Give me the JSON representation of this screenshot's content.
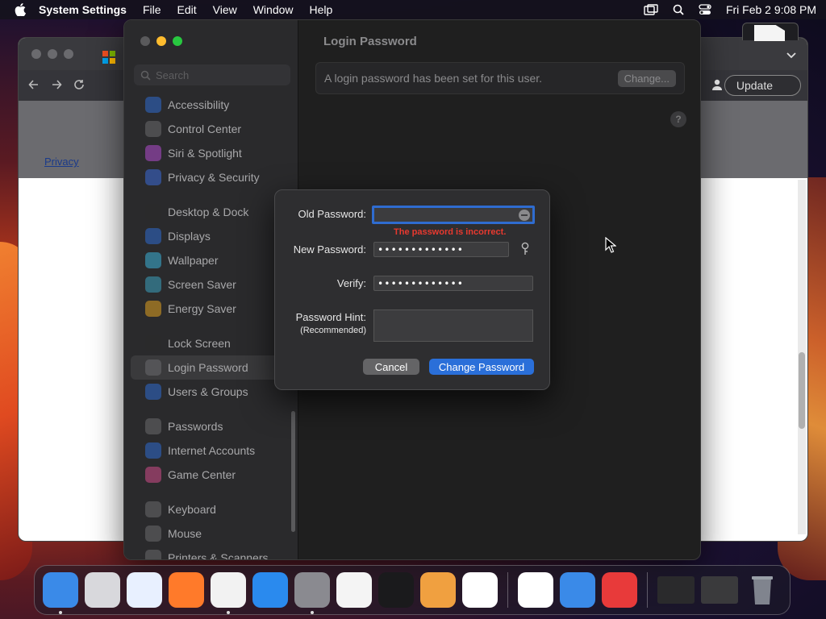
{
  "menubar": {
    "app_name": "System Settings",
    "items": [
      "File",
      "Edit",
      "View",
      "Window",
      "Help"
    ],
    "clock": "Fri Feb 2  9:08 PM"
  },
  "browser": {
    "privacy_link": "Privacy",
    "update_label": "Update"
  },
  "settings": {
    "search_placeholder": "Search",
    "sidebar": [
      {
        "label": "Accessibility",
        "icon": "accessibility-icon",
        "color": "#2e6ad0"
      },
      {
        "label": "Control Center",
        "icon": "control-center-icon",
        "color": "#6a6a6e"
      },
      {
        "label": "Siri & Spotlight",
        "icon": "siri-icon",
        "color": "#b04ad0"
      },
      {
        "label": "Privacy & Security",
        "icon": "hand-icon",
        "color": "#3a6ad8"
      },
      {
        "label": "Desktop & Dock",
        "icon": "desktop-icon",
        "color": "#2a2a2c"
      },
      {
        "label": "Displays",
        "icon": "displays-icon",
        "color": "#2e6ad0"
      },
      {
        "label": "Wallpaper",
        "icon": "wallpaper-icon",
        "color": "#3ab0d8"
      },
      {
        "label": "Screen Saver",
        "icon": "screen-saver-icon",
        "color": "#3aa0c0"
      },
      {
        "label": "Energy Saver",
        "icon": "energy-icon",
        "color": "#e0a020"
      },
      {
        "label": "Lock Screen",
        "icon": "lock-icon",
        "color": "#2a2a2c"
      },
      {
        "label": "Login Password",
        "icon": "login-password-icon",
        "color": "#6a6a6e"
      },
      {
        "label": "Users & Groups",
        "icon": "users-icon",
        "color": "#2e6ad0"
      },
      {
        "label": "Passwords",
        "icon": "key-icon",
        "color": "#6a6a6e"
      },
      {
        "label": "Internet Accounts",
        "icon": "at-icon",
        "color": "#2e6ad0"
      },
      {
        "label": "Game Center",
        "icon": "game-center-icon",
        "color": "#d04a8a"
      },
      {
        "label": "Keyboard",
        "icon": "keyboard-icon",
        "color": "#6a6a6e"
      },
      {
        "label": "Mouse",
        "icon": "mouse-icon",
        "color": "#6a6a6e"
      },
      {
        "label": "Printers & Scanners",
        "icon": "printer-icon",
        "color": "#6a6a6e"
      }
    ],
    "active_item": "Login Password",
    "pane_title": "Login Password",
    "info_text": "A login password has been set for this user.",
    "change_label": "Change...",
    "help_label": "?"
  },
  "dialog": {
    "old_password_label": "Old Password:",
    "old_password_value": "",
    "error_text": "The password is incorrect.",
    "new_password_label": "New Password:",
    "new_password_value": "•••••••••••••",
    "verify_label": "Verify:",
    "verify_value": "•••••••••••••",
    "hint_label": "Password Hint:",
    "hint_sub": "(Recommended)",
    "hint_value": "",
    "cancel_label": "Cancel",
    "submit_label": "Change Password"
  },
  "dock": [
    {
      "name": "finder",
      "color": "#3a8ae8",
      "running": true
    },
    {
      "name": "launchpad",
      "color": "#d8d8dc",
      "running": false
    },
    {
      "name": "safari",
      "color": "#e8f0ff",
      "running": false
    },
    {
      "name": "firefox",
      "color": "#ff7a2a",
      "running": false
    },
    {
      "name": "chrome",
      "color": "#f2f2f2",
      "running": true
    },
    {
      "name": "app-store",
      "color": "#2a8aee",
      "running": false
    },
    {
      "name": "system-settings",
      "color": "#8a8a90",
      "running": true
    },
    {
      "name": "textedit",
      "color": "#f4f4f4",
      "running": false
    },
    {
      "name": "terminal",
      "color": "#1a1a1c",
      "running": false
    },
    {
      "name": "garageband",
      "color": "#f0a040",
      "running": false
    },
    {
      "name": "vscode",
      "color": "#ffffff",
      "running": false
    },
    {
      "name": "visual-studio",
      "color": "#ffffff",
      "running": false
    },
    {
      "name": "weather",
      "color": "#3a8ae8",
      "running": false
    },
    {
      "name": "speedtest-app",
      "color": "#e83a3a",
      "running": false
    },
    {
      "name": "minimized-window-1",
      "color": "#2a2a2c",
      "running": false
    },
    {
      "name": "minimized-window-2",
      "color": "#3a3a3c",
      "running": false
    },
    {
      "name": "trash",
      "color": "#9aa0a8",
      "running": false
    }
  ]
}
